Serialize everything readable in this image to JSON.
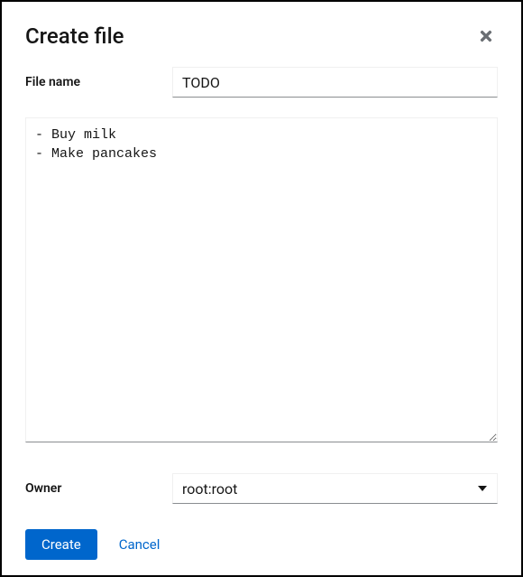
{
  "dialog": {
    "title": "Create file"
  },
  "fields": {
    "filename_label": "File name",
    "filename_value": "TODO",
    "content_value": "- Buy milk\n- Make pancakes",
    "owner_label": "Owner",
    "owner_value": "root:root"
  },
  "footer": {
    "create_label": "Create",
    "cancel_label": "Cancel"
  }
}
